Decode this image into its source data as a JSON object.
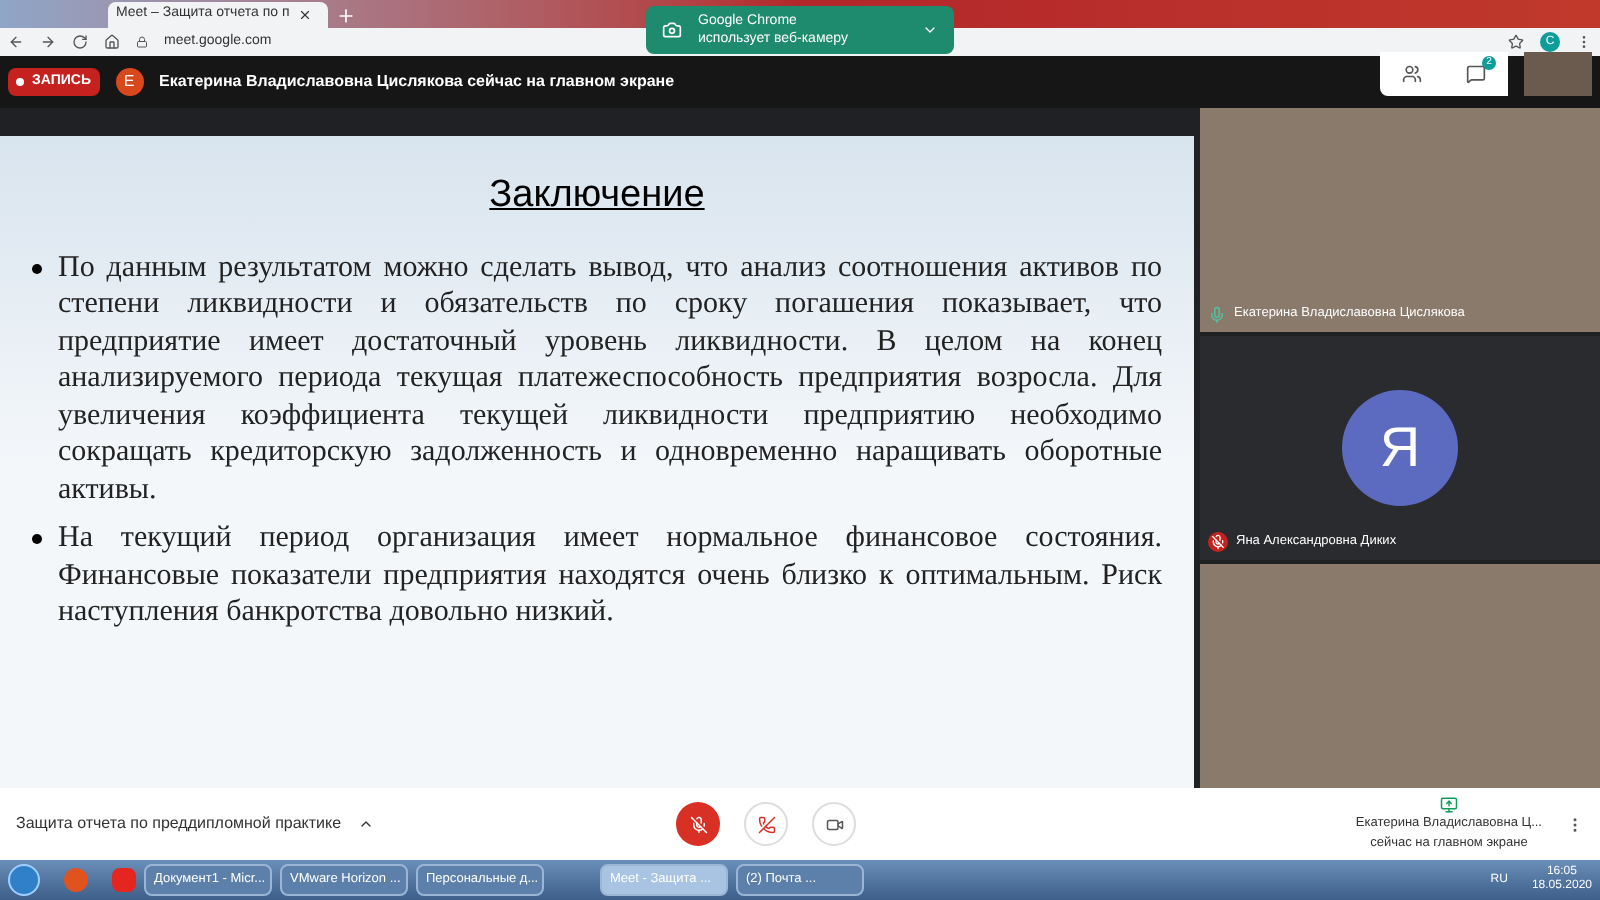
{
  "browser": {
    "tabs": [
      {
        "label": "Meet – Защита отчета по п",
        "selected": true
      }
    ],
    "url": "meet.google.com",
    "notification": {
      "title": "Google Chrome",
      "text": "использует веб-камеру"
    },
    "profile_initial": "С"
  },
  "meet_header": {
    "recording_label": "ЗАПИСЬ",
    "presenter_initial": "Е",
    "presenter_text": "Екатерина Владиславовна Цислякова сейчас на главном экране",
    "chat_badge": "2"
  },
  "slide": {
    "title": "Заключение",
    "bullets": [
      "По данным результатом можно сделать вывод, что анализ соотношения активов по степени ликвидности и обязательств по сроку погашения показывает, что предприятие имеет достаточный уровень ликвидности. В целом на конец анализируемого периода текущая платежеспособность предприятия возросла. Для увеличения коэффициента текущей ликвидности предприятию необходимо сокращать кредиторскую задолженность и одновременно наращивать оборотные активы.",
      "На текущий период организация имеет нормальное финансовое состояния. Финансовые показатели предприятия находятся очень близко к оптимальным. Риск наступления банкротства довольно низкий."
    ]
  },
  "participants": [
    {
      "kind": "video",
      "name": "Екатерина Владиславовна Цислякова",
      "muted": false
    },
    {
      "kind": "avatar",
      "initial": "Я",
      "name": "Яна Александровна Диких",
      "muted": true
    },
    {
      "kind": "video"
    }
  ],
  "bottom_bar": {
    "meeting_title": "Защита отчета по преддипломной практике",
    "mic_muted": true,
    "presenting_text": "Екатерина Владиславовна Ц...",
    "presenting_subtext": "сейчас на главном экране"
  },
  "taskbar": {
    "items": [
      {
        "label": "Документ1 - Micr...",
        "selected": false
      },
      {
        "label": "VMware Horizon ...",
        "selected": false
      },
      {
        "label": "Персональные д...",
        "selected": false
      },
      {
        "label": "Meet - Защита ...",
        "selected": true
      },
      {
        "label": "(2) Почта ...",
        "selected": false
      }
    ],
    "lang": "RU",
    "time": "16:05",
    "date": "18.05.2020"
  }
}
